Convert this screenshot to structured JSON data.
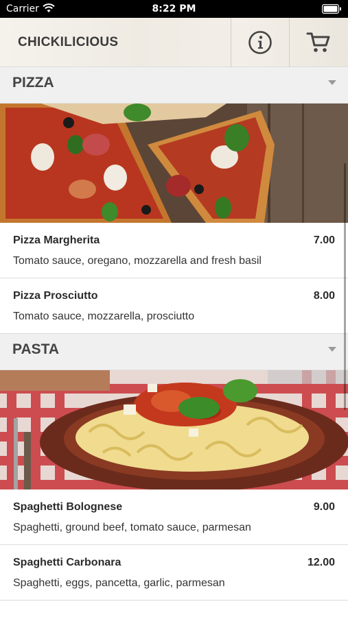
{
  "status_bar": {
    "carrier": "Carrier",
    "time": "8:22 PM"
  },
  "header": {
    "title": "CHICKILICIOUS",
    "info_icon": "info-icon",
    "cart_icon": "cart-icon"
  },
  "sections": [
    {
      "title": "PIZZA",
      "image_icon": "pizza-photo",
      "items": [
        {
          "name": "Pizza Margherita",
          "price": "7.00",
          "description": "Tomato sauce, oregano, mozzarella and fresh basil"
        },
        {
          "name": "Pizza Prosciutto",
          "price": "8.00",
          "description": "Tomato sauce, mozzarella, prosciutto"
        }
      ]
    },
    {
      "title": "PASTA",
      "image_icon": "pasta-photo",
      "items": [
        {
          "name": "Spaghetti Bolognese",
          "price": "9.00",
          "description": "Spaghetti, ground beef, tomato sauce, parmesan"
        },
        {
          "name": "Spaghetti Carbonara",
          "price": "12.00",
          "description": "Spaghetti, eggs, pancetta, garlic, parmesan"
        }
      ]
    }
  ],
  "colors": {
    "accent": "#3a3a3a",
    "section_bg": "#f0f0f0",
    "divider": "#dcdcdc"
  }
}
